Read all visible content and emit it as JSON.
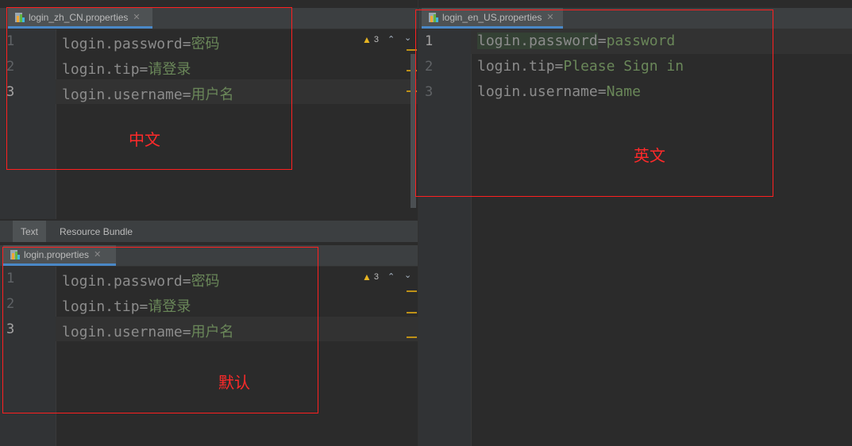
{
  "left_top": {
    "tab_label": "login_zh_CN.properties",
    "warning_count": "3",
    "lines": [
      {
        "num": "1",
        "key": "login.password",
        "eq": "=",
        "value": "密码"
      },
      {
        "num": "2",
        "key": "login.tip",
        "eq": "=",
        "value": "请登录"
      },
      {
        "num": "3",
        "key": "login.username",
        "eq": "=",
        "value": "用户名"
      }
    ],
    "annotation": "中文"
  },
  "editor_mode_tabs": [
    "Text",
    "Resource Bundle"
  ],
  "left_bottom": {
    "tab_label": "login.properties",
    "warning_count": "3",
    "lines": [
      {
        "num": "1",
        "key": "login.password",
        "eq": "=",
        "value": "密码"
      },
      {
        "num": "2",
        "key": "login.tip",
        "eq": "=",
        "value": "请登录"
      },
      {
        "num": "3",
        "key": "login.username",
        "eq": "=",
        "value": "用户名"
      }
    ],
    "annotation": "默认"
  },
  "right": {
    "tab_label": "login_en_US.properties",
    "lines": [
      {
        "num": "1",
        "key": "login.password",
        "eq": "=",
        "value": "password"
      },
      {
        "num": "2",
        "key": "login.tip",
        "eq": "=",
        "value": "Please Sign in"
      },
      {
        "num": "3",
        "key": "login.username",
        "eq": "=",
        "value": "Name"
      }
    ],
    "annotation": "英文"
  },
  "icons": {
    "file": "properties-file-icon",
    "close": "close-icon",
    "warning": "warning-icon",
    "prev": "chevron-up-icon",
    "next": "chevron-down-icon"
  },
  "colors": {
    "annotation_red": "#ff2a2a",
    "value_green": "#6a8759",
    "key_gray": "#8c8c8c",
    "warning_yellow": "#e6b422"
  }
}
